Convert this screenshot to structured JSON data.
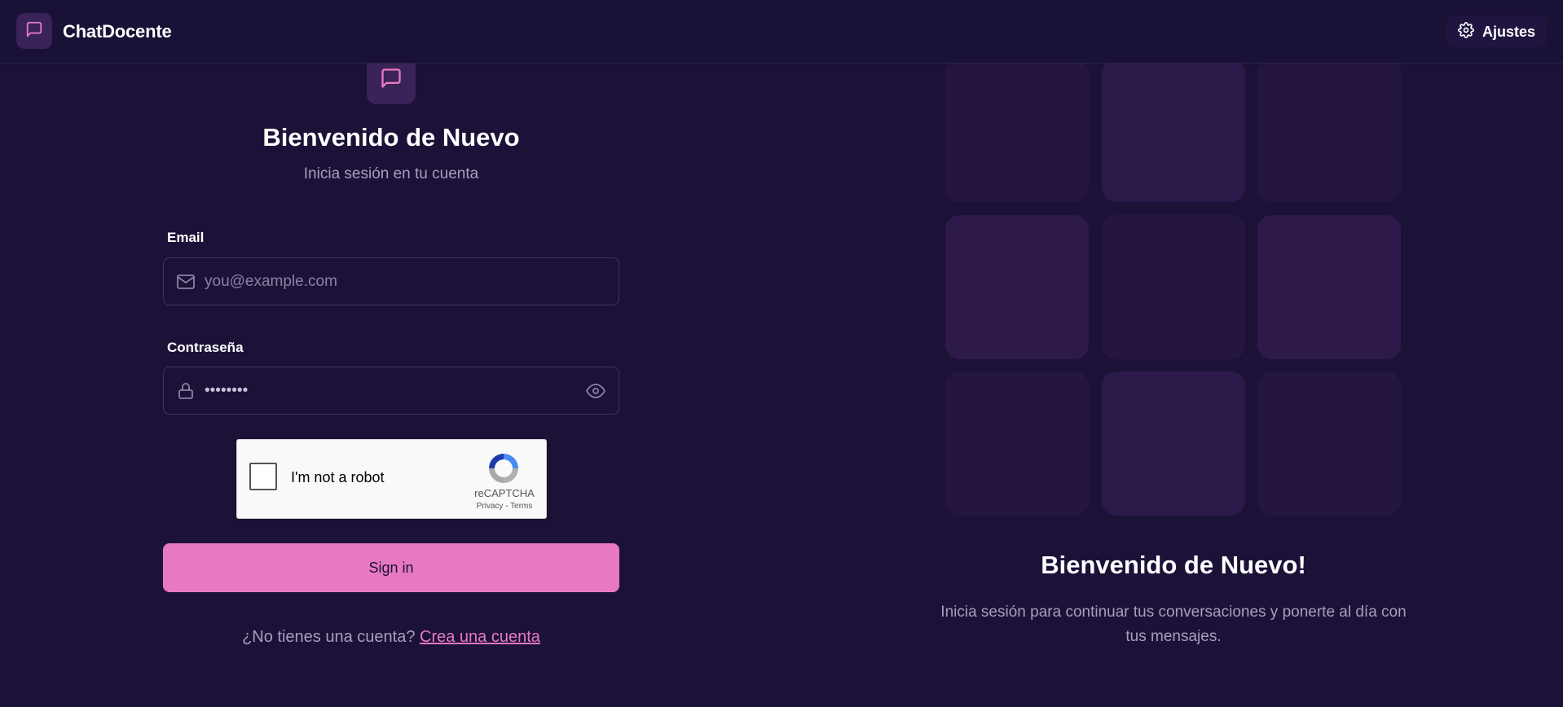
{
  "header": {
    "app_name": "ChatDocente",
    "settings_label": "Ajustes"
  },
  "login": {
    "title": "Bienvenido de Nuevo",
    "subtitle": "Inicia sesión en tu cuenta",
    "email_label": "Email",
    "email_placeholder": "you@example.com",
    "password_label": "Contraseña",
    "password_value": "••••••••",
    "signin_label": "Sign in",
    "no_account_text": "¿No tienes una cuenta?",
    "create_account_link": "Crea una cuenta"
  },
  "captcha": {
    "label": "I'm not a robot",
    "brand": "reCAPTCHA",
    "privacy": "Privacy",
    "separator": " - ",
    "terms": "Terms"
  },
  "welcome_panel": {
    "title": "Bienvenido de Nuevo!",
    "text": "Inicia sesión para continuar tus conversaciones y ponerte al día con tus mensajes."
  },
  "colors": {
    "background": "#1c1238",
    "accent": "#e879c0",
    "muted_text": "#a99cc0",
    "tile_light": "#2d1a4a",
    "tile_dark": "#25163f"
  }
}
